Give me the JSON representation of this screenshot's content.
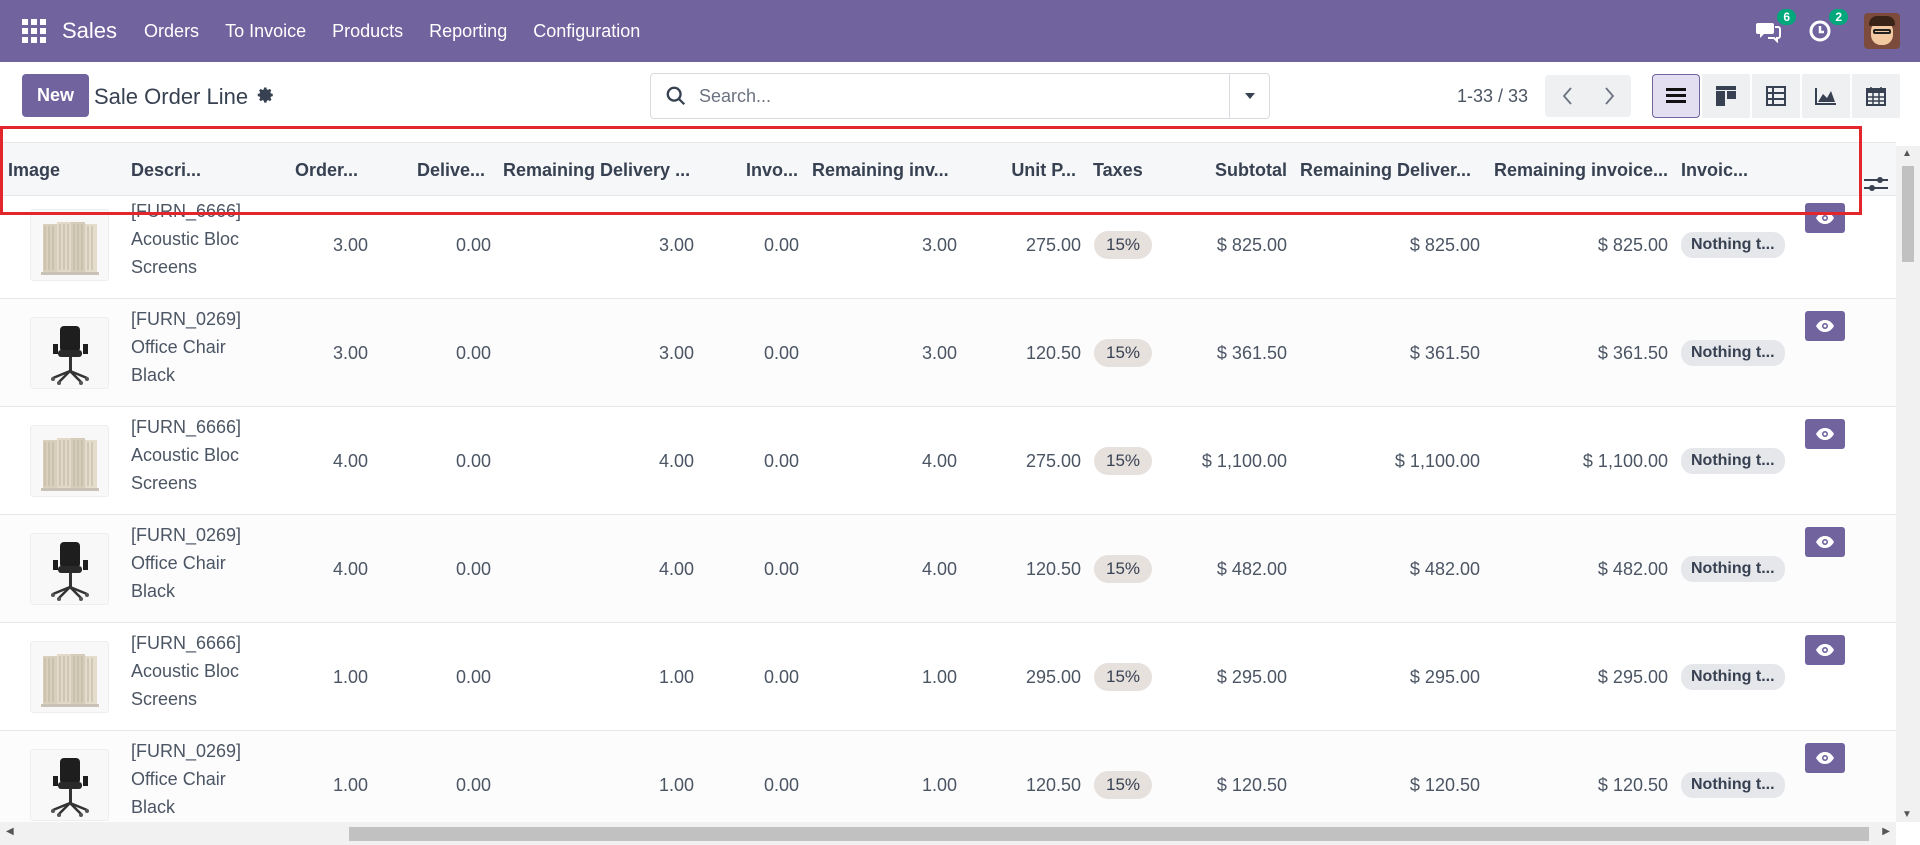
{
  "nav": {
    "app_name": "Sales",
    "menu": [
      "Orders",
      "To Invoice",
      "Products",
      "Reporting",
      "Configuration"
    ],
    "messages_count": "6",
    "activities_count": "2"
  },
  "control_panel": {
    "new_label": "New",
    "title": "Sale Order Line",
    "search_placeholder": "Search...",
    "pager": "1-33 / 33"
  },
  "columns": [
    "Image",
    "Descri...",
    "Order...",
    "Delive...",
    "Remaining Delivery ...",
    "Invo...",
    "Remaining inv...",
    "Unit P...",
    "Taxes",
    "Subtotal",
    "Remaining Deliver...",
    "Remaining invoice...",
    "Invoic..."
  ],
  "rows": [
    {
      "image": "screens-icon",
      "code": "[FURN_6666]",
      "name1": "Acoustic Bloc",
      "name2": "Screens",
      "ordered": "3.00",
      "delivered": "0.00",
      "rem_delivery": "3.00",
      "invoiced": "0.00",
      "rem_invoice": "3.00",
      "unit_price": "275.00",
      "taxes": "15%",
      "subtotal": "$ 825.00",
      "rem_delivered_amt": "$ 825.00",
      "rem_invoice_amt": "$ 825.00",
      "invoice_status": "Nothing t..."
    },
    {
      "image": "chair-icon",
      "code": "[FURN_0269]",
      "name1": "Office Chair",
      "name2": "Black",
      "ordered": "3.00",
      "delivered": "0.00",
      "rem_delivery": "3.00",
      "invoiced": "0.00",
      "rem_invoice": "3.00",
      "unit_price": "120.50",
      "taxes": "15%",
      "subtotal": "$ 361.50",
      "rem_delivered_amt": "$ 361.50",
      "rem_invoice_amt": "$ 361.50",
      "invoice_status": "Nothing t..."
    },
    {
      "image": "screens-icon",
      "code": "[FURN_6666]",
      "name1": "Acoustic Bloc",
      "name2": "Screens",
      "ordered": "4.00",
      "delivered": "0.00",
      "rem_delivery": "4.00",
      "invoiced": "0.00",
      "rem_invoice": "4.00",
      "unit_price": "275.00",
      "taxes": "15%",
      "subtotal": "$ 1,100.00",
      "rem_delivered_amt": "$ 1,100.00",
      "rem_invoice_amt": "$ 1,100.00",
      "invoice_status": "Nothing t..."
    },
    {
      "image": "chair-icon",
      "code": "[FURN_0269]",
      "name1": "Office Chair",
      "name2": "Black",
      "ordered": "4.00",
      "delivered": "0.00",
      "rem_delivery": "4.00",
      "invoiced": "0.00",
      "rem_invoice": "4.00",
      "unit_price": "120.50",
      "taxes": "15%",
      "subtotal": "$ 482.00",
      "rem_delivered_amt": "$ 482.00",
      "rem_invoice_amt": "$ 482.00",
      "invoice_status": "Nothing t..."
    },
    {
      "image": "screens-icon",
      "code": "[FURN_6666]",
      "name1": "Acoustic Bloc",
      "name2": "Screens",
      "ordered": "1.00",
      "delivered": "0.00",
      "rem_delivery": "1.00",
      "invoiced": "0.00",
      "rem_invoice": "1.00",
      "unit_price": "295.00",
      "taxes": "15%",
      "subtotal": "$ 295.00",
      "rem_delivered_amt": "$ 295.00",
      "rem_invoice_amt": "$ 295.00",
      "invoice_status": "Nothing t..."
    },
    {
      "image": "chair-icon",
      "code": "[FURN_0269]",
      "name1": "Office Chair",
      "name2": "Black",
      "ordered": "1.00",
      "delivered": "0.00",
      "rem_delivery": "1.00",
      "invoiced": "0.00",
      "rem_invoice": "1.00",
      "unit_price": "120.50",
      "taxes": "15%",
      "subtotal": "$ 120.50",
      "rem_delivered_amt": "$ 120.50",
      "rem_invoice_amt": "$ 120.50",
      "invoice_status": "Nothing t..."
    }
  ],
  "colors": {
    "brand": "#71639e",
    "highlight": "#e3262b",
    "badge_green": "#00a87c"
  }
}
